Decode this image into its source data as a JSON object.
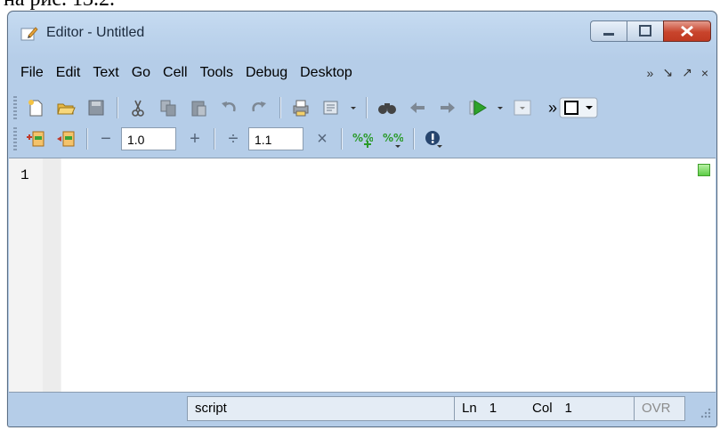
{
  "caption": "на рис. 13.2.",
  "window": {
    "title": "Editor - Untitled"
  },
  "menu": {
    "items": [
      "File",
      "Edit",
      "Text",
      "Go",
      "Cell",
      "Tools",
      "Debug",
      "Desktop"
    ],
    "right_glyphs": [
      "»",
      "↘",
      "↗",
      "×"
    ]
  },
  "toolbar": {
    "decrement_symbol": "−",
    "increment_symbol": "+",
    "divide_symbol": "÷",
    "multiply_symbol": "×",
    "first_value": "1.0",
    "second_value": "1.1",
    "more_symbol": "»"
  },
  "editor": {
    "line_number": "1"
  },
  "status": {
    "file_type": "script",
    "ln_label": "Ln",
    "ln_value": "1",
    "col_label": "Col",
    "col_value": "1",
    "ovr": "OVR"
  },
  "colors": {
    "frame": "#c6dbf1",
    "close_button": "#c8442c",
    "run_green": "#2da32a",
    "indicator_green": "#5dcc46"
  }
}
